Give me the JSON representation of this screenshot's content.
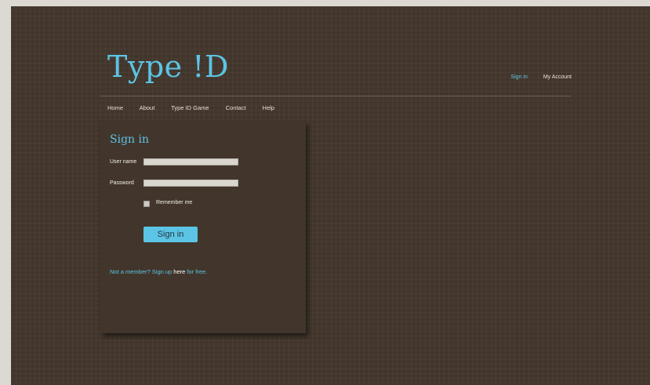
{
  "logo": {
    "part1": "Type ",
    "bang": "!",
    "part2": "D"
  },
  "topnav": {
    "signin": "Sign in",
    "account": "My Account"
  },
  "mainnav": [
    "Home",
    "About",
    "Type ID Game",
    "Contact",
    "Help"
  ],
  "form": {
    "title": "Sign in",
    "username_label": "User name",
    "username_value": "",
    "password_label": "Password",
    "password_value": "",
    "remember_label": "Remember me",
    "remember_checked": false,
    "submit_label": "Sign in",
    "footer_pre": "Not a member? Sign up ",
    "footer_link": "here",
    "footer_post": " for free."
  },
  "colors": {
    "accent": "#5cc4e4",
    "background": "#42362c",
    "outer": "#dcd8d2"
  }
}
